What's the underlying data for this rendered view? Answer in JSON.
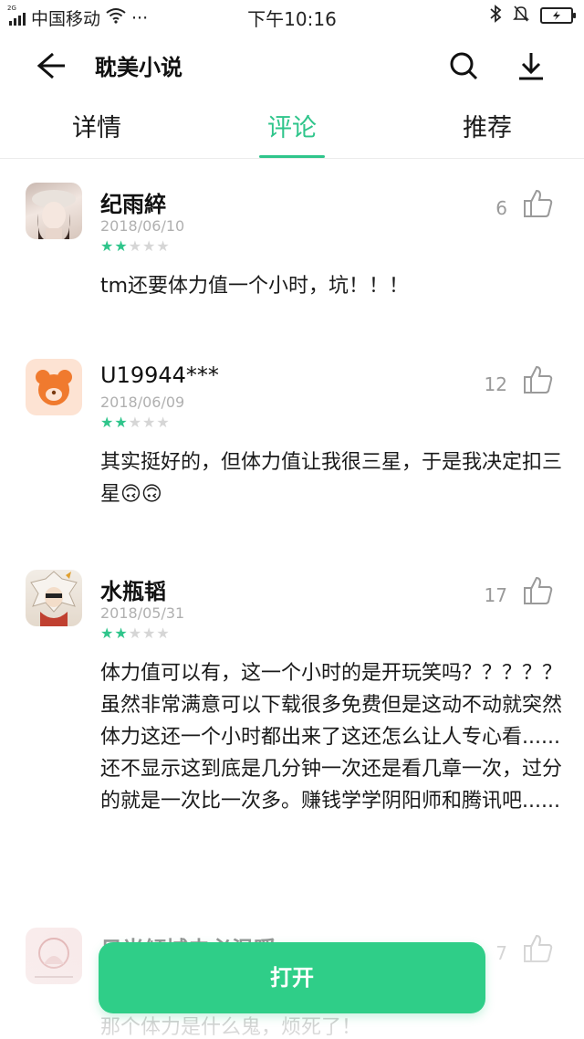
{
  "status_bar": {
    "network_tag": "2G",
    "carrier": "中国移动",
    "more": "···",
    "time": "下午10:16"
  },
  "header": {
    "title": "耽美小说"
  },
  "tabs": [
    {
      "label": "详情"
    },
    {
      "label": "评论"
    },
    {
      "label": "推荐"
    }
  ],
  "active_tab": "评论",
  "accent_color": "#2fc58b",
  "comments": [
    {
      "name": "纪雨綷",
      "date": "2018/06/10",
      "rating": 2,
      "likes": "6",
      "text": "tm还要体力值一个小时，坑！！！"
    },
    {
      "name": "U19944***",
      "date": "2018/06/09",
      "rating": 2,
      "likes": "12",
      "text": "其实挺好的，但体力值让我很三星，于是我决定扣三星🙃🙃"
    },
    {
      "name": "水瓶韬",
      "date": "2018/05/31",
      "rating": 2,
      "likes": "17",
      "text": "体力值可以有，这一个小时的是开玩笑吗？？？？？虽然非常满意可以下载很多免费但是这动不动就突然体力这还一个小时都出来了这还怎么让人专心看......还不显示这到底是几分钟一次还是看几章一次，过分的就是一次比一次多。赚钱学学阴阳师和腾讯吧......"
    },
    {
      "name": "日光倾城未必温暖",
      "likes": "7",
      "text": "那个体力是什么鬼，烦死了！"
    }
  ],
  "open_button": {
    "label": "打开"
  }
}
